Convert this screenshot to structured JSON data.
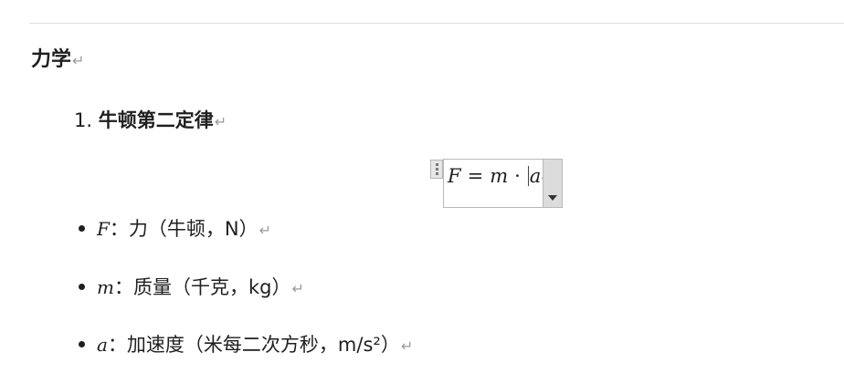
{
  "section_heading": "力学",
  "paragraph_mark": "↵",
  "list": {
    "number": "1.",
    "title": "牛顿第二定律"
  },
  "equation": {
    "lhs": "F",
    "equals": "=",
    "m": "m",
    "dot": "·",
    "a": "a"
  },
  "variables": [
    {
      "symbol": "F",
      "description": "：力（牛顿，N）"
    },
    {
      "symbol": "m",
      "description": "：质量（千克，kg）"
    },
    {
      "symbol": "a",
      "description": "：加速度（米每二次方秒，m/s²）"
    }
  ],
  "icons": {
    "paragraph_mark": "return-arrow-icon",
    "equation_handle": "drag-handle-icon",
    "equation_options": "chevron-down-icon"
  }
}
